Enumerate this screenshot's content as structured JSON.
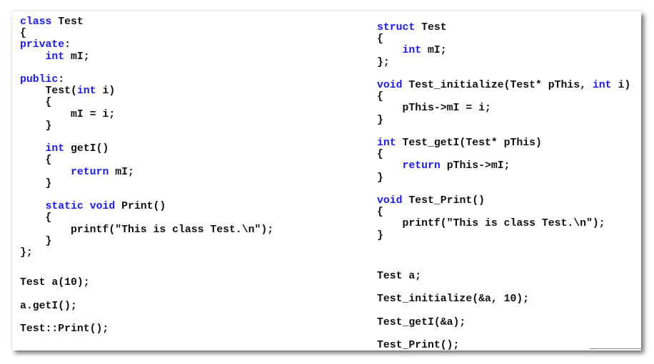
{
  "left_code": [
    [
      [
        "class",
        "kw"
      ],
      [
        " Test",
        ""
      ]
    ],
    [
      [
        "{",
        ""
      ]
    ],
    [
      [
        "private",
        "kw"
      ],
      [
        ":",
        ""
      ]
    ],
    [
      [
        "    ",
        ""
      ],
      [
        "int",
        "kw"
      ],
      [
        " mI;",
        ""
      ]
    ],
    [],
    [
      [
        "public",
        "kw"
      ],
      [
        ":",
        ""
      ]
    ],
    [
      [
        "    Test(",
        ""
      ],
      [
        "int",
        "kw"
      ],
      [
        " i)",
        ""
      ]
    ],
    [
      [
        "    {",
        ""
      ]
    ],
    [
      [
        "        mI = i;",
        ""
      ]
    ],
    [
      [
        "    }",
        ""
      ]
    ],
    [],
    [
      [
        "    ",
        ""
      ],
      [
        "int",
        "kw"
      ],
      [
        " getI()",
        ""
      ]
    ],
    [
      [
        "    {",
        ""
      ]
    ],
    [
      [
        "        ",
        ""
      ],
      [
        "return",
        "kw"
      ],
      [
        " mI;",
        ""
      ]
    ],
    [
      [
        "    }",
        ""
      ]
    ],
    [],
    [
      [
        "    ",
        ""
      ],
      [
        "static",
        "kw"
      ],
      [
        " ",
        ""
      ],
      [
        "void",
        "kw"
      ],
      [
        " Print()",
        ""
      ]
    ],
    [
      [
        "    {",
        ""
      ]
    ],
    [
      [
        "        printf(\"This is class Test.\\n\");",
        ""
      ]
    ],
    [
      [
        "    }",
        ""
      ]
    ],
    [
      [
        "};",
        ""
      ]
    ]
  ],
  "left_usage": [
    "Test a(10);",
    "a.getI();",
    "Test::Print();"
  ],
  "right_code": [
    [
      [
        "struct",
        "kw"
      ],
      [
        " Test",
        ""
      ]
    ],
    [
      [
        "{",
        ""
      ]
    ],
    [
      [
        "    ",
        ""
      ],
      [
        "int",
        "kw"
      ],
      [
        " mI;",
        ""
      ]
    ],
    [
      [
        "};",
        ""
      ]
    ],
    [],
    [
      [
        "void",
        "kw"
      ],
      [
        " Test_initialize(Test* pThis, ",
        ""
      ],
      [
        "int",
        "kw"
      ],
      [
        " i)",
        ""
      ]
    ],
    [
      [
        "{",
        ""
      ]
    ],
    [
      [
        "    pThis->mI = i;",
        ""
      ]
    ],
    [
      [
        "}",
        ""
      ]
    ],
    [],
    [
      [
        "int",
        "kw"
      ],
      [
        " Test_getI(Test* pThis)",
        ""
      ]
    ],
    [
      [
        "{",
        ""
      ]
    ],
    [
      [
        "    ",
        ""
      ],
      [
        "return",
        "kw"
      ],
      [
        " pThis->mI;",
        ""
      ]
    ],
    [
      [
        "}",
        ""
      ]
    ],
    [],
    [
      [
        "void",
        "kw"
      ],
      [
        " Test_Print()",
        ""
      ]
    ],
    [
      [
        "{",
        ""
      ]
    ],
    [
      [
        "    printf(\"This is class Test.\\n\");",
        ""
      ]
    ],
    [
      [
        "}",
        ""
      ]
    ]
  ],
  "right_usage": [
    "Test a;",
    "Test_initialize(&a, 10);",
    "Test_getI(&a);",
    "Test_Print();"
  ],
  "colors": {
    "keyword": "#1a1aff",
    "text": "#111111",
    "background": "#ffffff"
  }
}
